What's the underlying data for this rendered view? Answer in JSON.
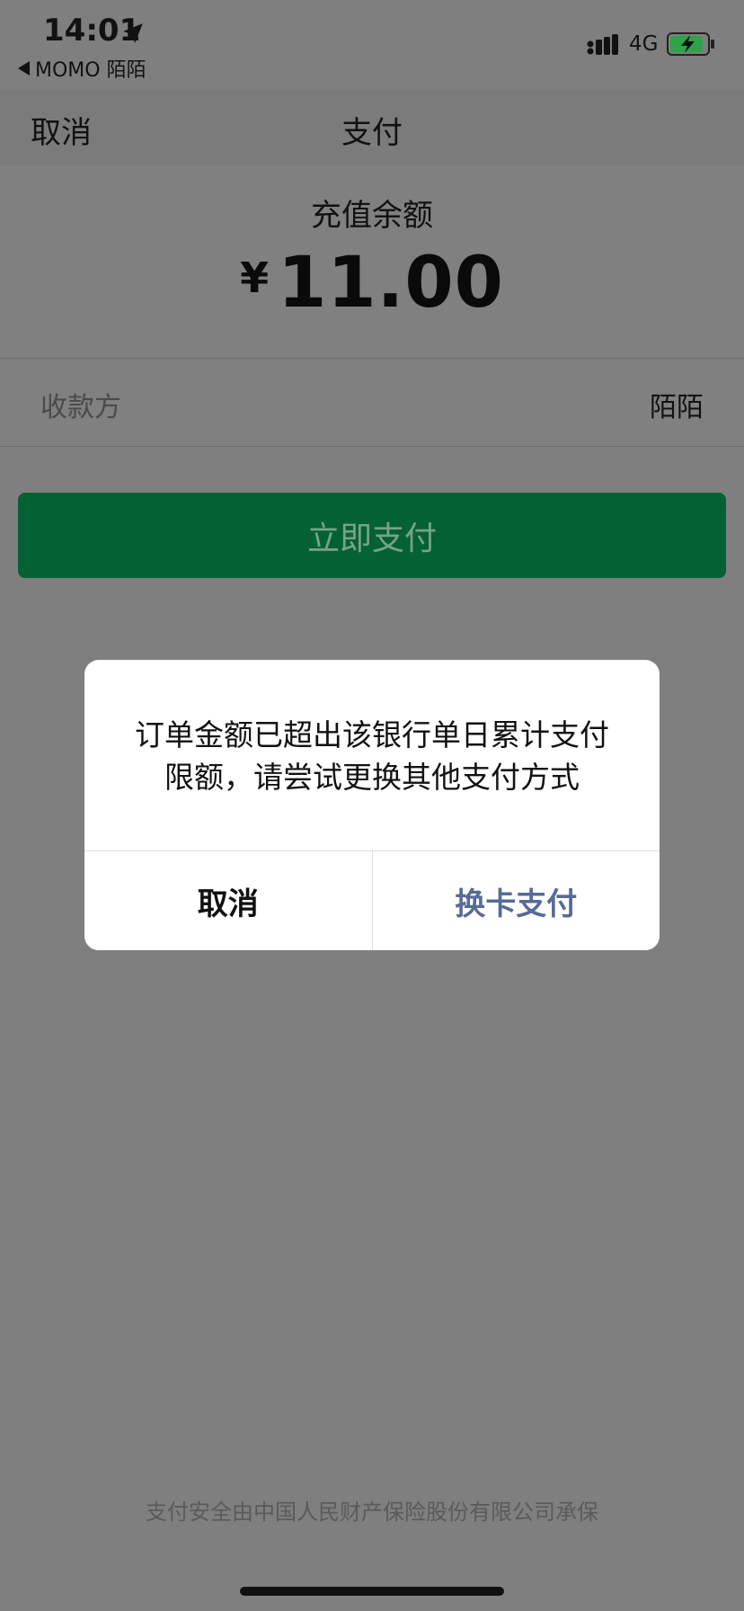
{
  "status": {
    "time": "14:01",
    "back_app": "MOMO 陌陌",
    "network": "4G"
  },
  "nav": {
    "cancel": "取消",
    "title": "支付"
  },
  "payment": {
    "amount_label": "充值余额",
    "currency": "¥",
    "amount": "11.00",
    "payee_label": "收款方",
    "payee_value": "陌陌",
    "pay_button": "立即支付"
  },
  "dialog": {
    "message": "订单金额已超出该银行单日累计支付限额，请尝试更换其他支付方式",
    "cancel": "取消",
    "switch_card": "换卡支付"
  },
  "footer": {
    "security_note": "支付安全由中国人民财产保险股份有限公司承保"
  },
  "colors": {
    "pay_button": "#046133",
    "dialog_link": "#576b95",
    "overlay": "#7f7f7f"
  },
  "icons": [
    "location-arrow-icon",
    "back-triangle-icon",
    "signal-icon",
    "battery-charging-icon"
  ]
}
